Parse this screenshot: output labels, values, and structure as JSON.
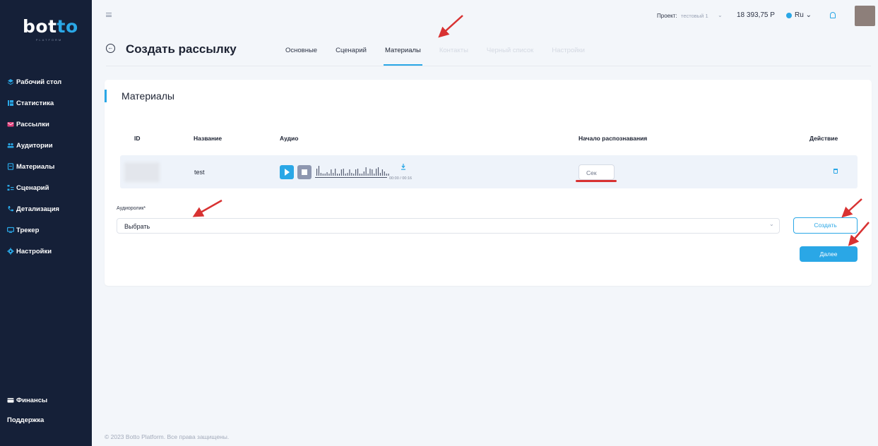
{
  "app": {
    "logo_main": "bot",
    "logo_accent": "to",
    "logo_sub": "PLATFORM"
  },
  "sidebar": {
    "items": [
      {
        "label": "Рабочий стол",
        "icon": "layers-icon",
        "color": "#2aa7e6"
      },
      {
        "label": "Статистика",
        "icon": "chart-icon",
        "color": "#2aa7e6"
      },
      {
        "label": "Рассылки",
        "icon": "mail-icon",
        "color": "#e0407b"
      },
      {
        "label": "Аудитории",
        "icon": "users-icon",
        "color": "#2aa7e6"
      },
      {
        "label": "Материалы",
        "icon": "file-icon",
        "color": "#2aa7e6"
      },
      {
        "label": "Сценарий",
        "icon": "flow-icon",
        "color": "#2aa7e6"
      },
      {
        "label": "Детализация",
        "icon": "phone-icon",
        "color": "#2aa7e6"
      },
      {
        "label": "Трекер",
        "icon": "monitor-icon",
        "color": "#2aa7e6"
      },
      {
        "label": "Настройки",
        "icon": "gear-icon",
        "color": "#2aa7e6"
      }
    ],
    "bottom": [
      {
        "label": "Финансы",
        "icon": "wallet-icon"
      },
      {
        "label": "Поддержка",
        "icon": ""
      }
    ]
  },
  "topbar": {
    "project_label": "Проект:",
    "project_value": "тестовый 1",
    "balance": "18 393,75 Р",
    "language": "Ru",
    "chevron": "⌄"
  },
  "page": {
    "title": "Создать рассылку",
    "tabs": [
      {
        "label": "Основные",
        "state": "normal"
      },
      {
        "label": "Сценарий",
        "state": "normal"
      },
      {
        "label": "Материалы",
        "state": "active"
      },
      {
        "label": "Контакты",
        "state": "disabled"
      },
      {
        "label": "Черный список",
        "state": "disabled"
      },
      {
        "label": "Настройки",
        "state": "disabled"
      }
    ]
  },
  "materials": {
    "title": "Материалы",
    "columns": {
      "id": "ID",
      "name": "Название",
      "audio": "Аудио",
      "recognition_start": "Начало распознавания",
      "action": "Действие"
    },
    "rows": [
      {
        "name": "test",
        "time": "00:00 / 00:16",
        "recognition_placeholder": "Сек"
      }
    ],
    "select_label": "Аудиоролик*",
    "select_value": "Выбрать",
    "create_button": "Создать",
    "next_button": "Далее"
  },
  "footer": "© 2023 Botto Platform. Все права защищены.",
  "colors": {
    "accent": "#2aa7e6",
    "sidebar_bg": "#152038",
    "annotation_red": "#d83232"
  }
}
